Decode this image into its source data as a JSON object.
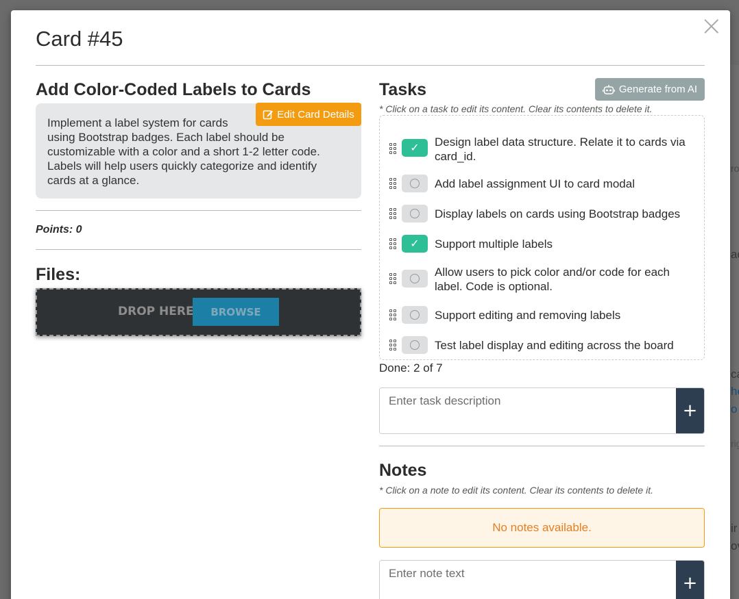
{
  "modal": {
    "title": "Card #45",
    "close_label": "×"
  },
  "card": {
    "heading": "Add Color-Coded Labels to Cards",
    "description": "Implement a label system for cards\nusing Bootstrap badges. Each label should be customizable with a color and a short 1-2 letter code. Labels will help users quickly categorize and identify cards at a glance.",
    "edit_label": "Edit Card Details",
    "points_label": "Points: 0"
  },
  "files": {
    "heading": "Files:",
    "drop_label": "DROP HERE",
    "browse_label": "BROWSE"
  },
  "tasks": {
    "heading": "Tasks",
    "generate_label": "Generate from AI",
    "hint": "* Click on a task to edit its content. Clear its contents to delete it.",
    "items": [
      {
        "text": "Design label data structure. Relate it to cards via card_id.",
        "done": true
      },
      {
        "text": "Add label assignment UI to card modal",
        "done": false
      },
      {
        "text": "Display labels on cards using Bootstrap badges",
        "done": false
      },
      {
        "text": "Support multiple labels",
        "done": true
      },
      {
        "text": "Allow users to pick color and/or code for each label. Code is optional.",
        "done": false
      },
      {
        "text": "Support editing and removing labels",
        "done": false
      },
      {
        "text": "Test label display and editing across the board",
        "done": false
      }
    ],
    "done_summary": "Done: 2 of 7",
    "input_placeholder": "Enter task description",
    "add_label": "+"
  },
  "notes": {
    "heading": "Notes",
    "hint": "* Click on a note to edit its content. Clear its contents to delete it.",
    "empty_message": "No notes available.",
    "input_placeholder": "Enter note text",
    "add_label": "+"
  },
  "colors": {
    "accent_orange": "#f39c12",
    "toggle_on": "#2fbf96",
    "dark_button": "#2c3e50",
    "browse_blue": "#1c7fa6"
  }
}
